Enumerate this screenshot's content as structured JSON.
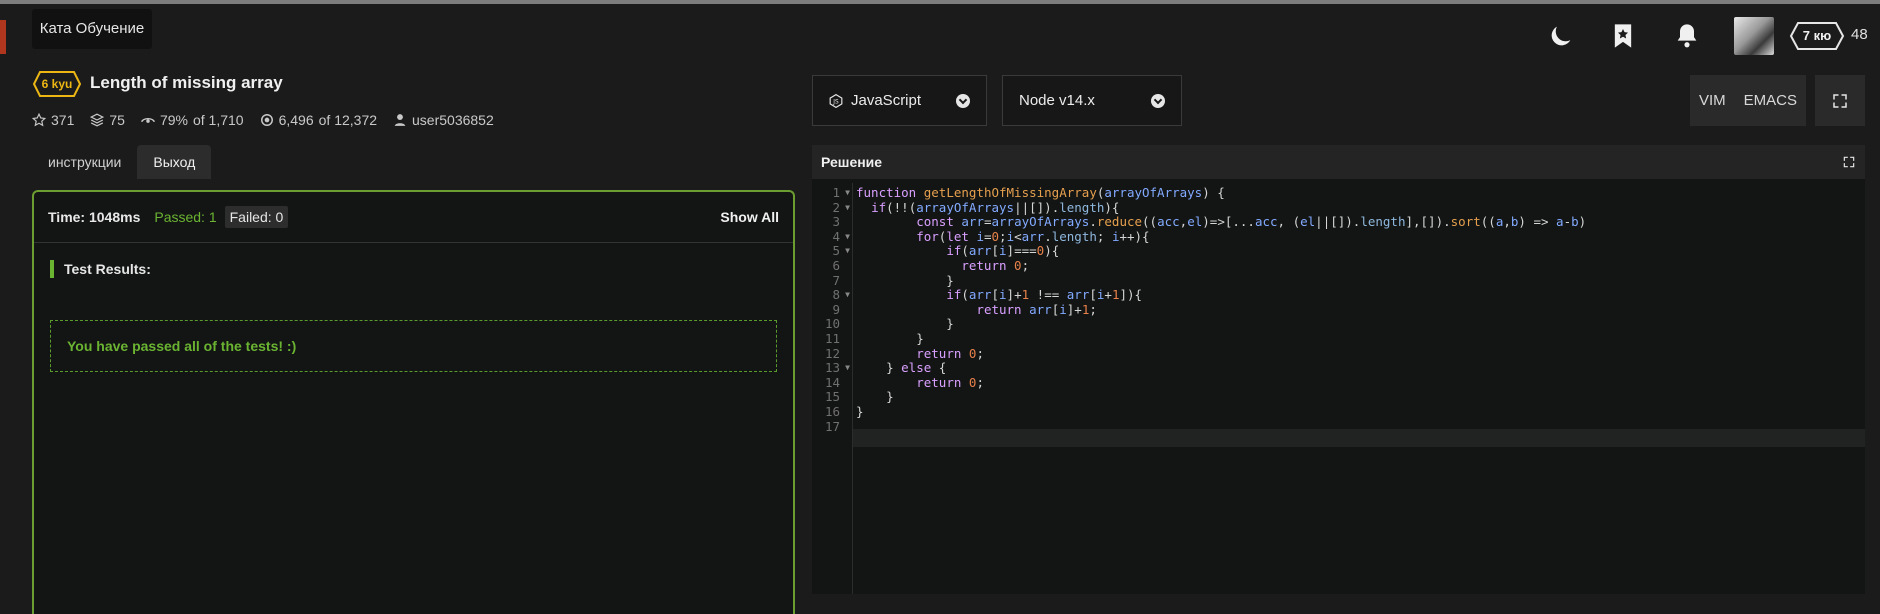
{
  "tooltip": "Ката Обучение",
  "header": {
    "rank": "7 кю",
    "honor": "48"
  },
  "kata": {
    "kyu": "6 kyu",
    "title": "Length of missing array",
    "stats": {
      "stars": "371",
      "collections": "75",
      "satisfaction": "79%",
      "satisfaction_of": "of 1,710",
      "completed": "6,496",
      "completed_of": "of 12,372",
      "author": "user5036852"
    }
  },
  "tabs": [
    "инструкции",
    "Выход"
  ],
  "output": {
    "time": "Time: 1048ms",
    "passed": "Passed: 1",
    "failed": "Failed: 0",
    "show_all": "Show All",
    "results_label": "Test Results:",
    "message": "You have passed all of the tests! :)"
  },
  "selects": {
    "language": "JavaScript",
    "version": "Node v14.x"
  },
  "modes": [
    "VIM",
    "EMACS"
  ],
  "editor": {
    "title": "Решение",
    "line_numbers": [
      "1",
      "2",
      "3",
      "4",
      "5",
      "6",
      "7",
      "8",
      "9",
      "10",
      "11",
      "12",
      "13",
      "14",
      "15",
      "16",
      "17"
    ],
    "code": [
      "function getLengthOfMissingArray(arrayOfArrays) {",
      "  if(!!(arrayOfArrays||[]).length){",
      "        const arr=arrayOfArrays.reduce((acc,el)=>[...acc, (el||[]).length],[]).sort((a,b) => a-b)",
      "        for(let i=0;i<arr.length; i++){",
      "            if(arr[i]===0){",
      "              return 0;",
      "            }",
      "            if(arr[i]+1 !== arr[i+1]){",
      "                return arr[i]+1;",
      "            }",
      "        }",
      "        return 0;",
      "    } else {",
      "        return 0;",
      "    }",
      "}",
      ""
    ]
  }
}
